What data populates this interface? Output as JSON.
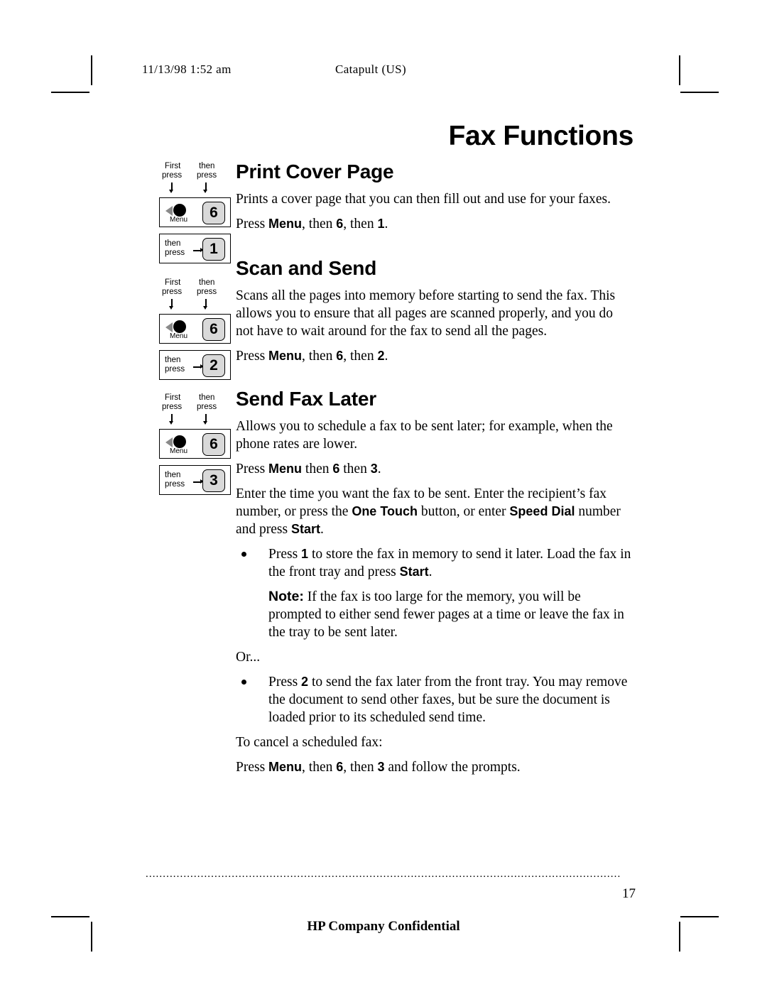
{
  "header": {
    "date": "11/13/98  1:52  am",
    "document": "Catapult (US)"
  },
  "title": "Fax Functions",
  "sections": [
    {
      "heading": "Print Cover Page",
      "paragraphs": [
        "Prints a cover page that you can then fill out and use for your faxes."
      ],
      "press_line": {
        "pre": "Press ",
        "menu": "Menu",
        "mid": ", then ",
        "key1": "6",
        "mid2": ", then ",
        "key2": "1",
        "end": "."
      },
      "keys": {
        "first_press": "First\npress",
        "then_press": "then\npress",
        "menu_label": "Menu",
        "num_top": "6",
        "num_bottom": "1",
        "then": "then",
        "press": "press"
      }
    },
    {
      "heading": "Scan and Send",
      "paragraphs": [
        "Scans all the pages into memory before starting to send the fax. This allows you to ensure that all pages are scanned properly, and you do not have to wait around for the fax to send all the pages."
      ],
      "press_line": {
        "pre": "Press ",
        "menu": "Menu",
        "mid": ", then ",
        "key1": "6",
        "mid2": ", then ",
        "key2": "2",
        "end": "."
      },
      "keys": {
        "num_top": "6",
        "num_bottom": "2"
      }
    },
    {
      "heading": "Send Fax Later",
      "paragraphs": [
        "Allows you to schedule a fax to be sent later; for example, when the phone rates are lower."
      ],
      "press_line": {
        "pre": "Press ",
        "menu": "Menu",
        "mid": " then ",
        "key1": "6",
        "mid2": " then ",
        "key2": "3",
        "end": "."
      },
      "keys": {
        "num_top": "6",
        "num_bottom": "3"
      }
    }
  ],
  "send_fax_later_detail": {
    "instructions_1": "Enter the time you want the fax to be sent. Enter the recipient’s fax number, or press the ",
    "one_touch": "One Touch",
    "instructions_2": " button, or enter ",
    "speed_dial": "Speed Dial",
    "instructions_3": " number and press ",
    "start_1": "Start",
    "instructions_4": ".",
    "bullet1_pre": "Press ",
    "bullet1_key": "1",
    "bullet1_mid": " to store the fax in memory to send it later. Load the fax in the front tray and press ",
    "bullet1_start": "Start",
    "bullet1_end": ".",
    "note_label": "Note:",
    "note_text": " If the fax is too large for the memory, you will be prompted to either send fewer pages at a time or leave the fax in the tray to be sent later.",
    "or_text": "Or...",
    "bullet2_pre": "Press ",
    "bullet2_key": "2",
    "bullet2_end": " to send the fax later from the front tray. You may remove the document to send other faxes, but be sure the document is loaded prior to its scheduled send time.",
    "cancel_intro": "To cancel a scheduled fax:",
    "cancel_pre": "Press ",
    "cancel_menu": "Menu",
    "cancel_mid": ", then ",
    "cancel_key1": "6",
    "cancel_mid2": ", then ",
    "cancel_key2": "3",
    "cancel_end": " and follow the prompts."
  },
  "labels": {
    "first": "First",
    "press": "press",
    "then": "then",
    "menu": "Menu"
  },
  "footer": {
    "dot_rule": "..........................................................................................................................................",
    "page_number": "17",
    "confidential": "HP Company Confidential"
  }
}
